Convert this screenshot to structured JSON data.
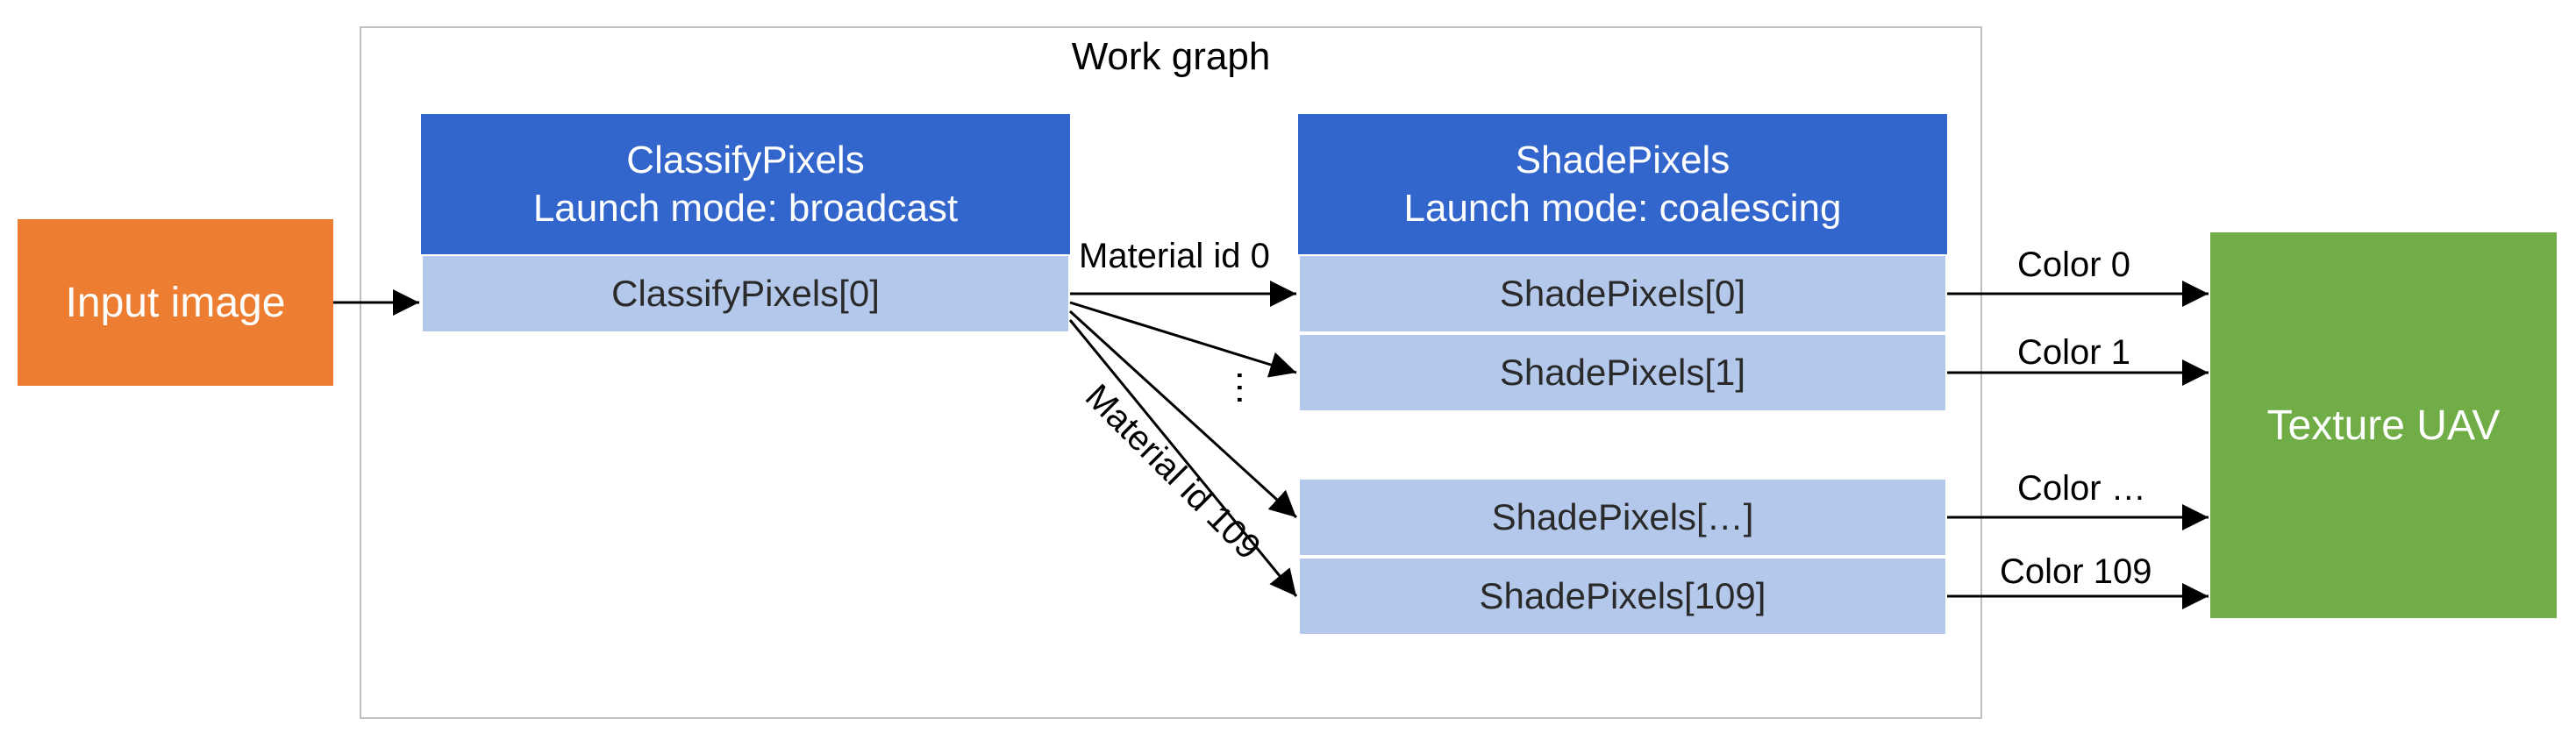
{
  "input": {
    "label": "Input image"
  },
  "workgraph": {
    "title": "Work graph"
  },
  "classify": {
    "title": "ClassifyPixels",
    "mode": "Launch mode: broadcast",
    "rows": [
      "ClassifyPixels[0]"
    ]
  },
  "shade": {
    "title": "ShadePixels",
    "mode": "Launch mode: coalescing",
    "rows": [
      "ShadePixels[0]",
      "ShadePixels[1]",
      "ShadePixels[…]",
      "ShadePixels[109]"
    ]
  },
  "output": {
    "label": "Texture UAV"
  },
  "edges": {
    "material_first": "Material id 0",
    "material_last": "Material id 109",
    "ellipsis": "…",
    "colors": [
      "Color 0",
      "Color 1",
      "Color …",
      "Color 109"
    ]
  }
}
